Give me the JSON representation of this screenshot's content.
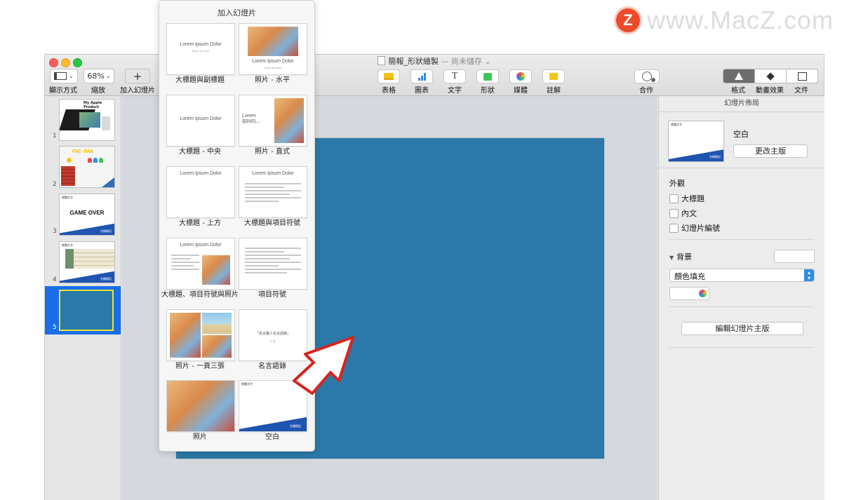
{
  "watermark": {
    "logo_letter": "Z",
    "text": "www.MacZ.com"
  },
  "window": {
    "title": "簡報_形狀繪製",
    "title_sep": " — ",
    "title_status": "尚未儲存"
  },
  "toolbar": {
    "view": {
      "label": "顯示方式",
      "icon": "sidebar-view-icon"
    },
    "zoom": {
      "label": "縮放",
      "value": "68%"
    },
    "add_slide": {
      "label": "加入幻燈片",
      "symbol": "+"
    },
    "insert": [
      {
        "label": "表格",
        "icon": "table-icon",
        "color": "#f5c31a"
      },
      {
        "label": "圖表",
        "icon": "chart-icon",
        "color": "#2f8de4"
      },
      {
        "label": "文字",
        "icon": "text-icon",
        "color": "#555555"
      },
      {
        "label": "形狀",
        "icon": "shape-icon",
        "color": "#3cc65a"
      },
      {
        "label": "媒體",
        "icon": "media-icon",
        "color": "#e0662c"
      },
      {
        "label": "註解",
        "icon": "comment-icon",
        "color": "#f5c31a"
      }
    ],
    "collaborate": {
      "label": "合作",
      "icon": "collaborate-icon"
    },
    "format": {
      "label": "格式",
      "icon": "paintbrush-icon"
    },
    "animate": {
      "label": "動畫效果",
      "icon": "diamond-icon"
    },
    "document": {
      "label": "文件",
      "icon": "document-icon"
    }
  },
  "navigator": {
    "slides": [
      {
        "num": "1",
        "title": "My Apple Product"
      },
      {
        "num": "2",
        "title": "PAC-MAN"
      },
      {
        "num": "3",
        "header": "標題文字",
        "title": "GAME OVER",
        "footer": "名稱標記"
      },
      {
        "num": "4",
        "header": "標題文字",
        "footer": "名稱標記"
      },
      {
        "num": "5"
      }
    ],
    "selected_index": 5
  },
  "popover": {
    "title": "加入幻燈片",
    "layouts": [
      {
        "label": "大標題與副標題",
        "text": "Lorem Ipsum Dolor",
        "sub": "Dolor sit amet"
      },
      {
        "label": "照片 - 水平",
        "text": "Lorem Ipsum Dolor",
        "sub": "Dolor sit amet"
      },
      {
        "label": "大標題 - 中央",
        "text": "Lorem Ipsum Dolor"
      },
      {
        "label": "照片 - 直式",
        "text": "Lorem Ipsum",
        "sub": "Dolor sit amet"
      },
      {
        "label": "大標題 - 上方",
        "text": "Lorem Ipsum Dolor"
      },
      {
        "label": "大標題與項目符號",
        "text": "Lorem Ipsum Dolor"
      },
      {
        "label": "大標題、項目符號與照片",
        "text": "Lorem Ipsum Dolor"
      },
      {
        "label": "項目符號"
      },
      {
        "label": "照片 - 一頁三張"
      },
      {
        "label": "名言語錄",
        "text": "「名言屬人名言語錄」",
        "sub": "人名"
      },
      {
        "label": "照片"
      },
      {
        "label": "空白",
        "header": "標題文字",
        "footer": "名稱標記"
      }
    ]
  },
  "inspector": {
    "header": "幻燈片佈局",
    "master_name": "空白",
    "change_master": "更改主版",
    "appearance_title": "外觀",
    "checkboxes": [
      "大標題",
      "內文",
      "幻燈片編號"
    ],
    "background_title": "背景",
    "fill_select": "顏色填充",
    "edit_master": "編輯幻燈片主版",
    "thumb_header": "標題文字",
    "thumb_footer": "名稱標記"
  },
  "colors": {
    "slide_background": "#2a79a9",
    "selection": "#1a6fe8",
    "arrow_outline": "#d8231d"
  }
}
